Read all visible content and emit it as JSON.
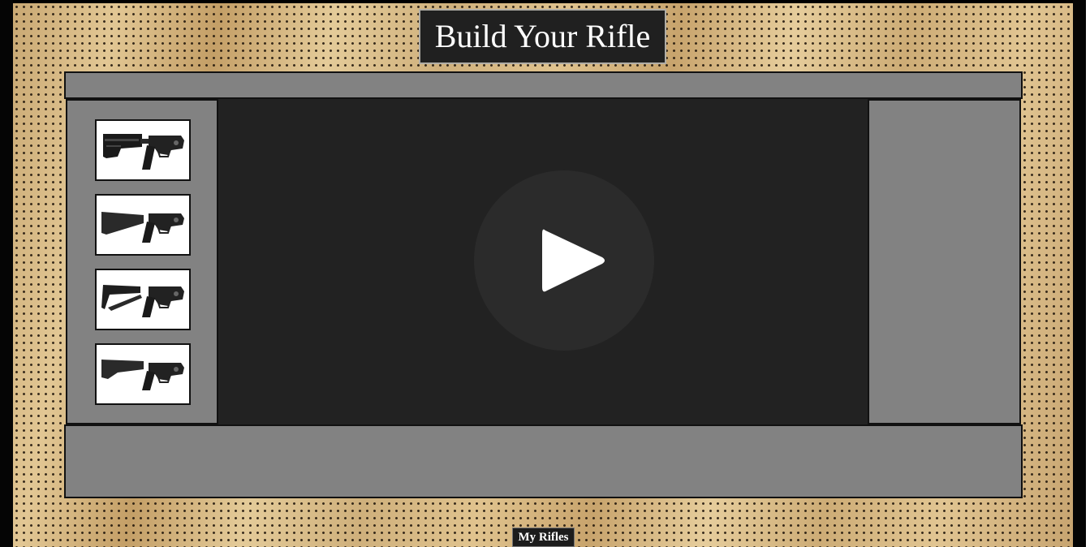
{
  "page": {
    "title": "Build Your Rifle",
    "my_rifles_label": "My Rifles"
  },
  "lower_receiver_options": [
    {
      "icon": "lower-receiver-collapsible-stock-icon"
    },
    {
      "icon": "lower-receiver-fixed-stock-icon"
    },
    {
      "icon": "lower-receiver-skeleton-stock-icon"
    },
    {
      "icon": "lower-receiver-precision-stock-icon"
    }
  ],
  "video": {
    "play_icon": "play-icon"
  },
  "colors": {
    "panel": "#828282",
    "video_bg": "#222222",
    "title_bg": "#202020",
    "pegboard": "#d6b882"
  }
}
